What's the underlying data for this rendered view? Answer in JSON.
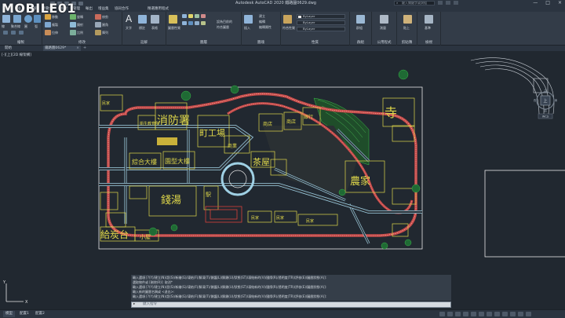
{
  "watermark": {
    "text": "MOBILE01"
  },
  "titlebar": {
    "title": "Autodesk AutoCAD 2020   鐵路圖0629.dwg",
    "search_placeholder": "鍵入關鍵字或詞組",
    "window_controls": [
      "—",
      "□",
      "×"
    ]
  },
  "menu": {
    "tabs": [
      "常用",
      "插入",
      "註解",
      "參數式",
      "檢視",
      "管理",
      "輸出",
      "增益集",
      "協同合作",
      "精選應用程式"
    ]
  },
  "ribbon": {
    "groups": [
      {
        "label": "繪製",
        "items": [
          "線",
          "聚合線",
          "圓",
          "弧"
        ]
      },
      {
        "label": "修改",
        "items": [
          "移動",
          "旋轉",
          "修剪",
          "複製",
          "鏡射",
          "圓角",
          "拉伸",
          "比例",
          "陣列"
        ]
      },
      {
        "label": "註解",
        "items": [
          "文字",
          "標註",
          "表格"
        ]
      },
      {
        "label": "圖層",
        "items": [
          "圖層性質",
          "設為目前的",
          "符合圖層"
        ]
      },
      {
        "label": "圖塊",
        "items": [
          "插入",
          "建立",
          "編輯",
          "編輯屬性"
        ]
      },
      {
        "label": "性質",
        "items": [
          "符合性質",
          "ByLayer",
          "ByLayer",
          "ByLayer"
        ]
      },
      {
        "label": "群組",
        "items": [
          "群組"
        ]
      },
      {
        "label": "公用程式",
        "items": [
          "測量"
        ]
      },
      {
        "label": "剪貼簿",
        "items": [
          "貼上"
        ]
      },
      {
        "label": "檢視",
        "items": [
          "基準"
        ]
      }
    ]
  },
  "file_tabs": {
    "start": "開始",
    "active": "鐵路圖0629*"
  },
  "viewport": {
    "label": "[-][上][2D 線架構]"
  },
  "viewcube": {
    "face": "上",
    "north": "北",
    "south": "南",
    "east": "東",
    "west": "西",
    "wcs": "WCS"
  },
  "drawing": {
    "labels": {
      "fire_station": "消防署",
      "factory": "町工場",
      "health_school": "衛生教育所",
      "bathhouse": "錢湯",
      "hotel": "綜合大樓",
      "cinema": "園型大樓",
      "water_tower": "給炭台",
      "small_house": "小屋",
      "tea_house": "茶屋",
      "temple": "寺",
      "farm": "農家",
      "shop1": "商業",
      "shop2": "商店",
      "shop3": "商店",
      "bank": "銀行",
      "house1": "民家",
      "house2": "民家",
      "house3": "民家",
      "house4": "民家",
      "station": "駅"
    }
  },
  "command": {
    "history": [
      "輸入選項 [?(Y)/建立(N)/設(S)/新繪(G)/凍結(F)/解凍(T)/鎖護(L)/解鎖(U)/狀態(ST)/凍結新的(V)/國際(R)/透明度(TR)/評核(E)/圖層狀態(A)]:",
      "選取物件或 [刪除(R)]: 取消*",
      "輸入選項 [?(Y)/建立(N)/設(S)/新繪(G)/凍結(F)/解凍(T)/鎖護(L)/解鎖(U)/狀態(ST)/凍結新的(V)/國際(R)/透明度(TR)/評核(E)/圖層狀態(A)]:",
      "輸入新的圖層名稱或 <退出>:",
      "輸入選項 [?(Y)/建立(N)/設(S)/新繪(G)/凍結(F)/解凍(T)/鎖護(L)/解鎖(U)/狀態(ST)/凍結新的(V)/國際(R)/透明度(TR)/評核(E)/圖層狀態(A)]:"
    ],
    "placeholder": "鍵入指令"
  },
  "statusbar": {
    "tabs": [
      "模型",
      "配置1",
      "配置2"
    ],
    "icons": [
      "model-space-icon",
      "grid-icon",
      "snap-icon",
      "ortho-icon",
      "polar-icon",
      "osnap-icon",
      "lineweight-icon",
      "annotation-icon",
      "workspace-icon",
      "isolate-icon",
      "fullscreen-icon",
      "customize-icon"
    ]
  }
}
